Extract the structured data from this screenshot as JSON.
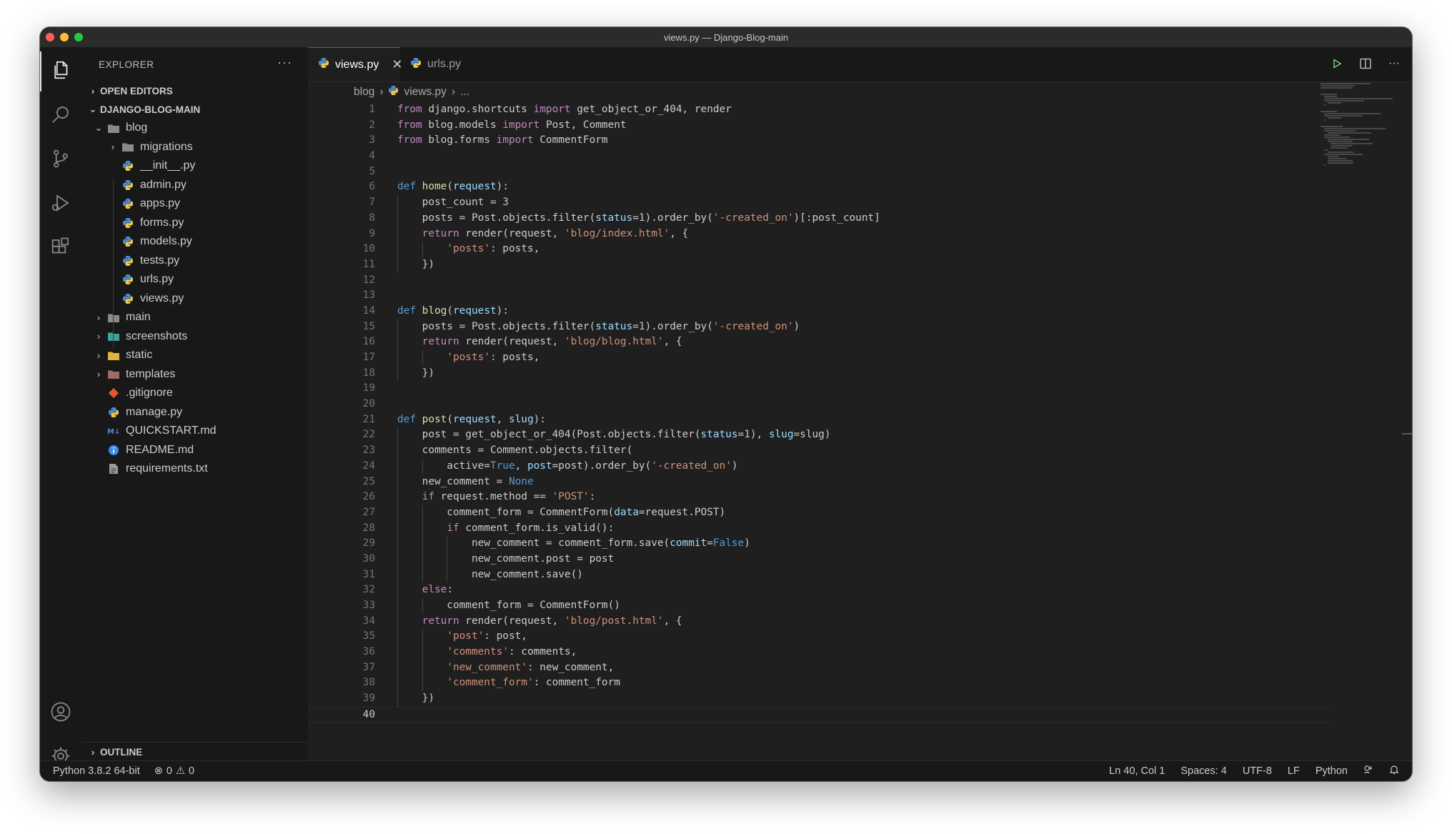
{
  "window": {
    "title": "views.py — Django-Blog-main"
  },
  "activity_bar": {
    "top": [
      "files-icon",
      "search-icon",
      "source-control-icon",
      "run-debug-icon",
      "extensions-icon"
    ],
    "bottom": [
      "account-icon",
      "settings-gear-icon"
    ]
  },
  "sidebar": {
    "header": "EXPLORER",
    "more": "···",
    "open_editors": "OPEN EDITORS",
    "project": "DJANGO-BLOG-MAIN",
    "outline": "OUTLINE",
    "tree": [
      {
        "name": "blog",
        "kind": "folder",
        "depth": 1,
        "expanded": true
      },
      {
        "name": "migrations",
        "kind": "folder",
        "depth": 2,
        "expanded": false
      },
      {
        "name": "__init__.py",
        "kind": "py",
        "depth": 2
      },
      {
        "name": "admin.py",
        "kind": "py",
        "depth": 2
      },
      {
        "name": "apps.py",
        "kind": "py",
        "depth": 2
      },
      {
        "name": "forms.py",
        "kind": "py",
        "depth": 2
      },
      {
        "name": "models.py",
        "kind": "py",
        "depth": 2
      },
      {
        "name": "tests.py",
        "kind": "py",
        "depth": 2
      },
      {
        "name": "urls.py",
        "kind": "py",
        "depth": 2
      },
      {
        "name": "views.py",
        "kind": "py",
        "depth": 2
      },
      {
        "name": "main",
        "kind": "folder",
        "depth": 1,
        "expanded": false
      },
      {
        "name": "screenshots",
        "kind": "folder-teal",
        "depth": 1,
        "expanded": false
      },
      {
        "name": "static",
        "kind": "folder-yellow",
        "depth": 1,
        "expanded": false
      },
      {
        "name": "templates",
        "kind": "folder-red",
        "depth": 1,
        "expanded": false
      },
      {
        "name": ".gitignore",
        "kind": "git",
        "depth": 1
      },
      {
        "name": "manage.py",
        "kind": "py",
        "depth": 1
      },
      {
        "name": "QUICKSTART.md",
        "kind": "md",
        "depth": 1
      },
      {
        "name": "README.md",
        "kind": "info",
        "depth": 1
      },
      {
        "name": "requirements.txt",
        "kind": "txt",
        "depth": 1
      }
    ]
  },
  "tabs": [
    {
      "label": "views.py",
      "active": true,
      "close": "✕"
    },
    {
      "label": "urls.py",
      "active": false
    }
  ],
  "breadcrumb": {
    "folder": "blog",
    "file": "views.py",
    "more": "..."
  },
  "editor": {
    "current_line": 40,
    "lines": [
      "from django.shortcuts import get_object_or_404, render",
      "from blog.models import Post, Comment",
      "from blog.forms import CommentForm",
      "",
      "",
      "def home(request):",
      "    post_count = 3",
      "    posts = Post.objects.filter(status=1).order_by('-created_on')[:post_count]",
      "    return render(request, 'blog/index.html', {",
      "        'posts': posts,",
      "    })",
      "",
      "",
      "def blog(request):",
      "    posts = Post.objects.filter(status=1).order_by('-created_on')",
      "    return render(request, 'blog/blog.html', {",
      "        'posts': posts,",
      "    })",
      "",
      "",
      "def post(request, slug):",
      "    post = get_object_or_404(Post.objects.filter(status=1), slug=slug)",
      "    comments = Comment.objects.filter(",
      "        active=True, post=post).order_by('-created_on')",
      "    new_comment = None",
      "    if request.method == 'POST':",
      "        comment_form = CommentForm(data=request.POST)",
      "        if comment_form.is_valid():",
      "            new_comment = comment_form.save(commit=False)",
      "            new_comment.post = post",
      "            new_comment.save()",
      "    else:",
      "        comment_form = CommentForm()",
      "    return render(request, 'blog/post.html', {",
      "        'post': post,",
      "        'comments': comments,",
      "        'new_comment': new_comment,",
      "        'comment_form': comment_form",
      "    })",
      ""
    ]
  },
  "editor_actions": [
    "run-icon",
    "split-editor-icon",
    "more-actions-icon"
  ],
  "status_bar": {
    "interpreter": "Python 3.8.2 64-bit",
    "errors": "0",
    "warnings": "0",
    "position": "Ln 40, Col 1",
    "spaces": "Spaces: 4",
    "encoding": "UTF-8",
    "eol": "LF",
    "language": "Python"
  },
  "colors": {
    "keyword": "#c586c0",
    "def": "#569cd6",
    "function": "#dcdcaa",
    "string": "#ce9178",
    "number": "#b5cea8",
    "parameter": "#9cdcfe",
    "accent": "#0078d4"
  }
}
